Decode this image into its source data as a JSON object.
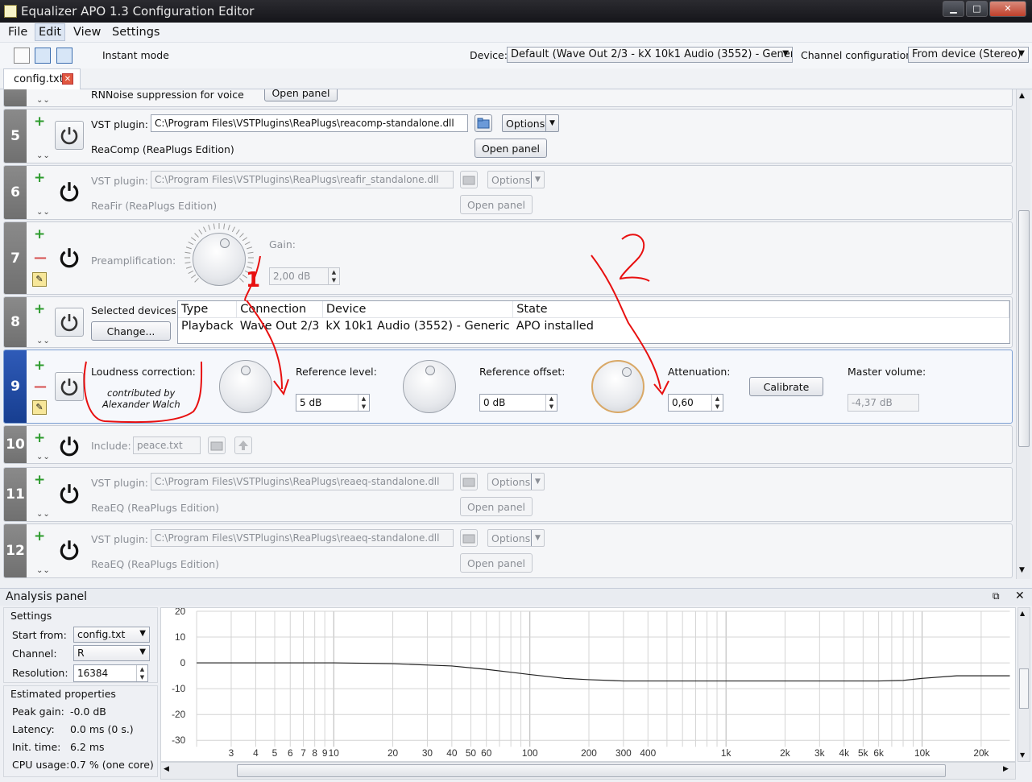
{
  "window": {
    "title": "Equalizer APO 1.3 Configuration Editor",
    "controls": {
      "minimize": "▁",
      "maximize": "□",
      "close": "✕"
    }
  },
  "menu": [
    "File",
    "Edit",
    "View",
    "Settings"
  ],
  "toolbar": {
    "instant_mode_label": "Instant mode",
    "instant_mode_checked": true,
    "device_label": "Device:",
    "device_value": "Default (Wave Out 2/3 - kX 10k1 Audio (3552) - Generic)",
    "channel_label": "Channel configuration:",
    "channel_value": "From device (Stereo)"
  },
  "tabs": [
    {
      "label": "config.txt"
    }
  ],
  "rows": {
    "partial": {
      "label": "RNNoise suppression for voice",
      "button": "Open panel"
    },
    "r5": {
      "num": "5",
      "vst_label": "VST plugin:",
      "path": "C:\\Program Files\\VSTPlugins\\ReaPlugs\\reacomp-standalone.dll",
      "options": "Options",
      "plugin_name": "ReaComp (ReaPlugs Edition)",
      "open_panel": "Open panel"
    },
    "r6": {
      "num": "6",
      "vst_label": "VST plugin:",
      "path": "C:\\Program Files\\VSTPlugins\\ReaPlugs\\reafir_standalone.dll",
      "options": "Options",
      "plugin_name": "ReaFir (ReaPlugs Edition)",
      "open_panel": "Open panel"
    },
    "r7": {
      "num": "7",
      "label": "Preamplification:",
      "gain_label": "Gain:",
      "gain_value": "2,00 dB"
    },
    "r8": {
      "num": "8",
      "selected_label": "Selected devices:",
      "change_button": "Change...",
      "headers": [
        "Type",
        "Connection",
        "Device",
        "State"
      ],
      "values": [
        "Playback",
        "Wave Out 2/3",
        "kX 10k1 Audio (3552) - Generic",
        "APO installed"
      ]
    },
    "r9": {
      "num": "9",
      "label": "Loudness correction:",
      "contrib_1": "contributed by",
      "contrib_2": "Alexander Walch",
      "ref_level_label": "Reference level:",
      "ref_level_value": "5 dB",
      "ref_offset_label": "Reference offset:",
      "ref_offset_value": "0 dB",
      "atten_label": "Attenuation:",
      "atten_value": "0,60",
      "calibrate": "Calibrate",
      "master_label": "Master volume:",
      "master_value": "-4,37 dB"
    },
    "r10": {
      "num": "10",
      "label": "Include:",
      "value": "peace.txt"
    },
    "r11": {
      "num": "11",
      "vst_label": "VST plugin:",
      "path": "C:\\Program Files\\VSTPlugins\\ReaPlugs\\reaeq-standalone.dll",
      "options": "Options",
      "plugin_name": "ReaEQ (ReaPlugs Edition)",
      "open_panel": "Open panel"
    },
    "r12": {
      "num": "12",
      "vst_label": "VST plugin:",
      "path": "C:\\Program Files\\VSTPlugins\\ReaPlugs\\reaeq-standalone.dll",
      "options": "Options",
      "plugin_name": "ReaEQ (ReaPlugs Edition)",
      "open_panel": "Open panel"
    }
  },
  "annotations": {
    "one": "1",
    "two": "2"
  },
  "analysis": {
    "title": "Analysis panel",
    "settings_title": "Settings",
    "start_from_label": "Start from:",
    "start_from_value": "config.txt",
    "channel_label": "Channel:",
    "channel_value": "R",
    "resolution_label": "Resolution:",
    "resolution_value": "16384",
    "estimated_title": "Estimated properties",
    "props": [
      {
        "label": "Peak gain:",
        "value": "-0.0 dB"
      },
      {
        "label": "Latency:",
        "value": "0.0 ms (0 s.)"
      },
      {
        "label": "Init. time:",
        "value": "6.2 ms"
      },
      {
        "label": "CPU usage:",
        "value": "0.7 % (one core)"
      }
    ]
  },
  "chart_data": {
    "type": "line",
    "title": "",
    "xlabel": "",
    "ylabel": "",
    "x_scale": "log",
    "xlim": [
      2,
      28000
    ],
    "ylim": [
      -30,
      20
    ],
    "grid": true,
    "y_ticks": [
      "20",
      "10",
      "0",
      "-10",
      "-20",
      "-30"
    ],
    "x_ticks": [
      {
        "v": 3,
        "l": "3"
      },
      {
        "v": 4,
        "l": "4"
      },
      {
        "v": 5,
        "l": "5"
      },
      {
        "v": 6,
        "l": "6"
      },
      {
        "v": 7,
        "l": "7"
      },
      {
        "v": 8,
        "l": "8"
      },
      {
        "v": 9,
        "l": "9"
      },
      {
        "v": 10,
        "l": "10"
      },
      {
        "v": 20,
        "l": "20"
      },
      {
        "v": 30,
        "l": "30"
      },
      {
        "v": 40,
        "l": "40"
      },
      {
        "v": 50,
        "l": "50"
      },
      {
        "v": 60,
        "l": "60"
      },
      {
        "v": 100,
        "l": "100"
      },
      {
        "v": 200,
        "l": "200"
      },
      {
        "v": 300,
        "l": "300"
      },
      {
        "v": 400,
        "l": "400"
      },
      {
        "v": 1000,
        "l": "1k"
      },
      {
        "v": 2000,
        "l": "2k"
      },
      {
        "v": 3000,
        "l": "3k"
      },
      {
        "v": 4000,
        "l": "4k"
      },
      {
        "v": 5000,
        "l": "5k"
      },
      {
        "v": 6000,
        "l": "6k"
      },
      {
        "v": 10000,
        "l": "10k"
      },
      {
        "v": 20000,
        "l": "20k"
      }
    ],
    "series": [
      {
        "x": [
          2,
          10,
          20,
          40,
          60,
          100,
          150,
          200,
          300,
          500,
          1000,
          3000,
          6000,
          8000,
          10000,
          15000,
          20000,
          28000
        ],
        "y": [
          0,
          0,
          -0.3,
          -1.2,
          -2.5,
          -4.5,
          -6,
          -6.5,
          -7,
          -7,
          -7,
          -7,
          -7,
          -6.8,
          -6,
          -5,
          -5,
          -5
        ]
      }
    ]
  },
  "colors": {
    "annotation_red": "#e81010",
    "selected_row": "#2f5bb8"
  }
}
